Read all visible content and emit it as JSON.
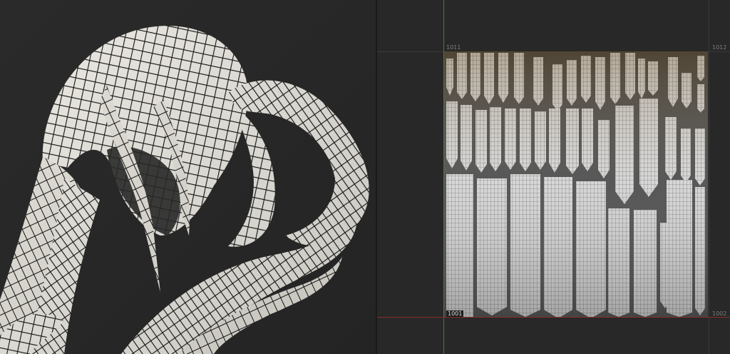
{
  "uv_editor": {
    "tile_labels": {
      "top_left": "1011",
      "top_right": "1012",
      "bottom_main": "1001",
      "bottom_right": "1002"
    }
  },
  "colors": {
    "background": "#262626",
    "hair_base": "#e8e6df",
    "checker_line": "#1a1a1a",
    "y_axis": "#4b7a3c",
    "x_axis": "#8a2d2d"
  }
}
